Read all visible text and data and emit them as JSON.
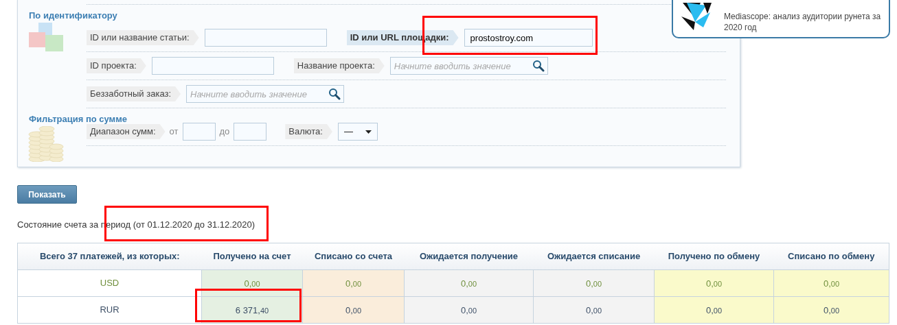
{
  "filter": {
    "sections": [
      {
        "title": "По идентификатору",
        "kind": "cubes",
        "rows": [
          [
            {
              "kind": "text",
              "label": "ID или название статьи:",
              "highlighted": false
            },
            {
              "kind": "text",
              "label": "ID или URL площадки:",
              "highlighted": true,
              "value": "prostostroy.com"
            }
          ],
          [
            {
              "kind": "text",
              "label": "ID проекта:",
              "highlighted": false
            },
            {
              "kind": "search",
              "label": "Название проекта:",
              "highlighted": false,
              "placeholder": "Начните вводить значение"
            }
          ],
          [
            {
              "kind": "search",
              "label": "Беззаботный заказ:",
              "highlighted": false,
              "placeholder": "Начните вводить значение"
            }
          ]
        ]
      },
      {
        "title": "Фильтрация по сумме",
        "kind": "coins",
        "rows": [
          [
            {
              "kind": "range",
              "label": "Диапазон сумм:",
              "highlighted": false,
              "from": "от",
              "to": "до"
            },
            {
              "kind": "select",
              "label": "Валюта:",
              "highlighted": false,
              "value": "—"
            }
          ]
        ]
      }
    ]
  },
  "show_button": "Показать",
  "period": "Состояние счета за период (от 01.12.2020 до 31.12.2020)",
  "table": {
    "columns": [
      {
        "label": "Всего 37 платежей, из которых:"
      },
      {
        "label": "Получено на счет",
        "color": "#e5f0e2"
      },
      {
        "label": "Списано со счета",
        "color": "#faeddb"
      },
      {
        "label": "Ожидается получение",
        "color": "#f3f3f3"
      },
      {
        "label": "Ожидается списание",
        "color": "#f3f3f3"
      },
      {
        "label": "Получено по обмену",
        "color": "#fafacb"
      },
      {
        "label": "Списано по обмену",
        "color": "#fafacb"
      }
    ],
    "rows": [
      {
        "currency": "USD",
        "color": "#6f8f3c",
        "values": [
          "0,00",
          "0,00",
          "0,00",
          "0,00",
          "0,00",
          "0,00"
        ]
      },
      {
        "currency": "RUR",
        "color": "#3d4f66",
        "values": [
          "6 371,40",
          "0,00",
          "0,00",
          "0,00",
          "0,00",
          "0,00"
        ]
      }
    ]
  },
  "notification": {
    "text": "Mediascope: анализ аудитории рунета за 2020 год"
  }
}
